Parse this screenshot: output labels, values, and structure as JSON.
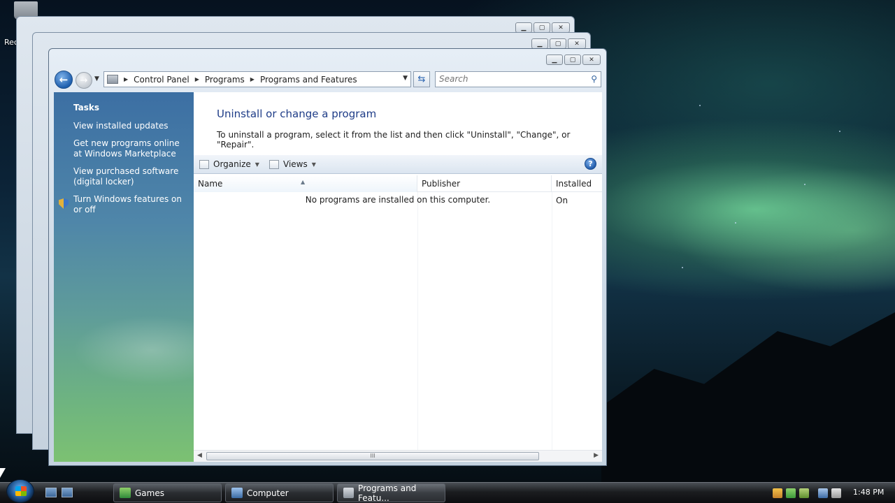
{
  "desktop": {
    "recycle_label": "Rec"
  },
  "window": {
    "minimize_glyph": "▁",
    "maximize_glyph": "▢",
    "close_glyph": "✕",
    "address": {
      "crumbs": [
        "Control Panel",
        "Programs",
        "Programs and Features"
      ]
    },
    "search_placeholder": "Search"
  },
  "tasks": {
    "title": "Tasks",
    "items": [
      "View installed updates",
      "Get new programs online at Windows Marketplace",
      "View purchased software (digital locker)",
      "Turn Windows features on or off"
    ]
  },
  "main": {
    "heading": "Uninstall or change a program",
    "description": "To uninstall a program, select it from the list and then click \"Uninstall\", \"Change\", or \"Repair\".",
    "toolbar": {
      "organize": "Organize",
      "views": "Views",
      "help": "?"
    },
    "columns": [
      "Name",
      "Publisher",
      "Installed On"
    ],
    "empty_message": "No programs are installed on this computer.",
    "scroll_grip": "III"
  },
  "taskbar": {
    "buttons": [
      "Games",
      "Computer",
      "Programs and Featu..."
    ],
    "clock": "1:48 PM"
  },
  "colors": {
    "accent_heading": "#1e3c87",
    "pane_top": "#3c6fa3",
    "pane_bottom": "#7cc172"
  }
}
